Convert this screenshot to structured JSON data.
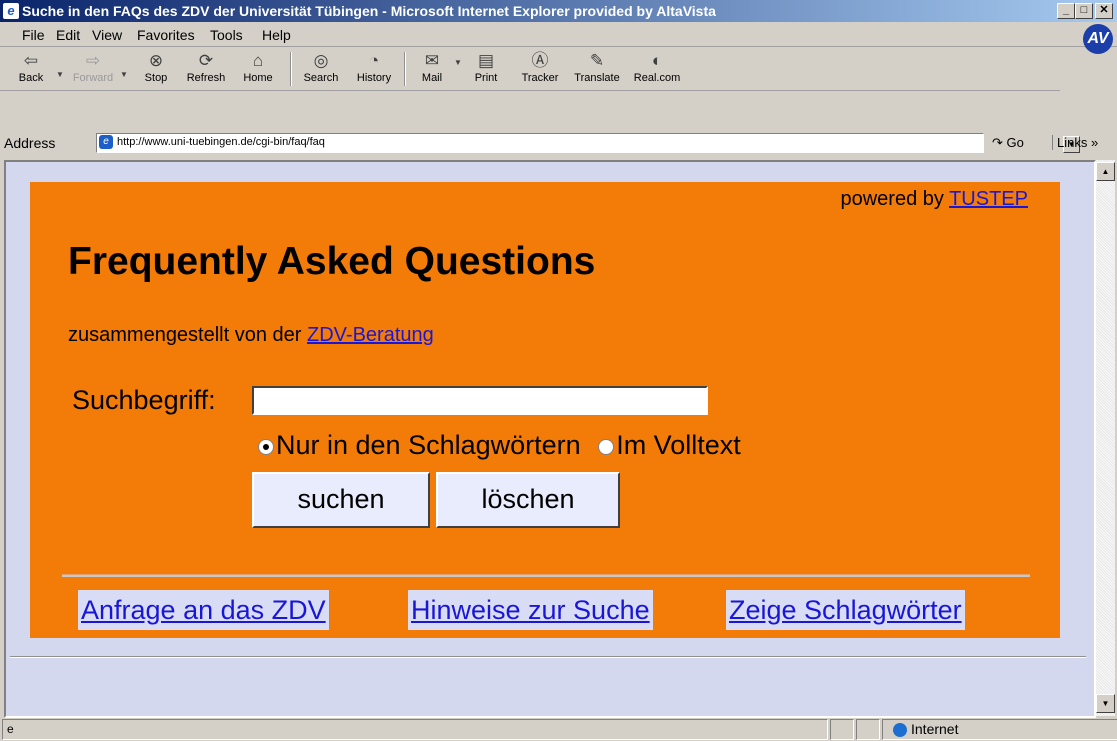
{
  "window": {
    "title": "Suche in den FAQs des ZDV der Universität Tübingen - Microsoft Internet Explorer provided by AltaVista",
    "icon": "ie-icon",
    "brand_logo": "AV"
  },
  "menu": {
    "items": [
      "File",
      "Edit",
      "View",
      "Favorites",
      "Tools",
      "Help"
    ]
  },
  "toolbar": {
    "buttons": [
      {
        "label": "Back",
        "icon": "back-arrow-icon",
        "glyph": "⇦"
      },
      {
        "label": "Forward",
        "icon": "forward-arrow-icon",
        "glyph": "⇨"
      },
      {
        "label": "Stop",
        "icon": "stop-icon",
        "glyph": "⊗"
      },
      {
        "label": "Refresh",
        "icon": "refresh-icon",
        "glyph": "⟳"
      },
      {
        "label": "Home",
        "icon": "home-icon",
        "glyph": "⌂"
      },
      {
        "label": "Search",
        "icon": "search-icon",
        "glyph": "◎"
      },
      {
        "label": "History",
        "icon": "history-icon",
        "glyph": "◔"
      },
      {
        "label": "Mail",
        "icon": "mail-icon",
        "glyph": "✉"
      },
      {
        "label": "Print",
        "icon": "print-icon",
        "glyph": "▤"
      },
      {
        "label": "Tracker",
        "icon": "tracker-icon",
        "glyph": "Ⓐ"
      },
      {
        "label": "Translate",
        "icon": "translate-icon",
        "glyph": "✎"
      },
      {
        "label": "Real.com",
        "icon": "realcom-icon",
        "glyph": "◐"
      }
    ]
  },
  "address": {
    "label": "Address",
    "url": "http://www.uni-tuebingen.de/cgi-bin/faq/faq",
    "go_label": "Go",
    "links_label": "Links »"
  },
  "page": {
    "powered_prefix": "powered by",
    "powered_link": "TUSTEP",
    "heading": "Frequently Asked Questions",
    "subtitle_prefix": "zusammengestellt von der",
    "subtitle_link": "ZDV-Beratung",
    "search_label": "Suchbegriff:",
    "search_value": "",
    "radio_keywords": "Nur in den Schlagwörtern",
    "radio_fulltext": "Im Volltext",
    "search_button": "suchen",
    "clear_button": "löschen",
    "footer_links": [
      "Anfrage an das ZDV",
      "Hinweise zur Suche",
      "Zeige Schlagwörter"
    ]
  },
  "status": {
    "zone": "Internet"
  },
  "colors": {
    "page_background": "#f27c07",
    "link": "#1a16d8",
    "titlebar": "#0a246a"
  }
}
